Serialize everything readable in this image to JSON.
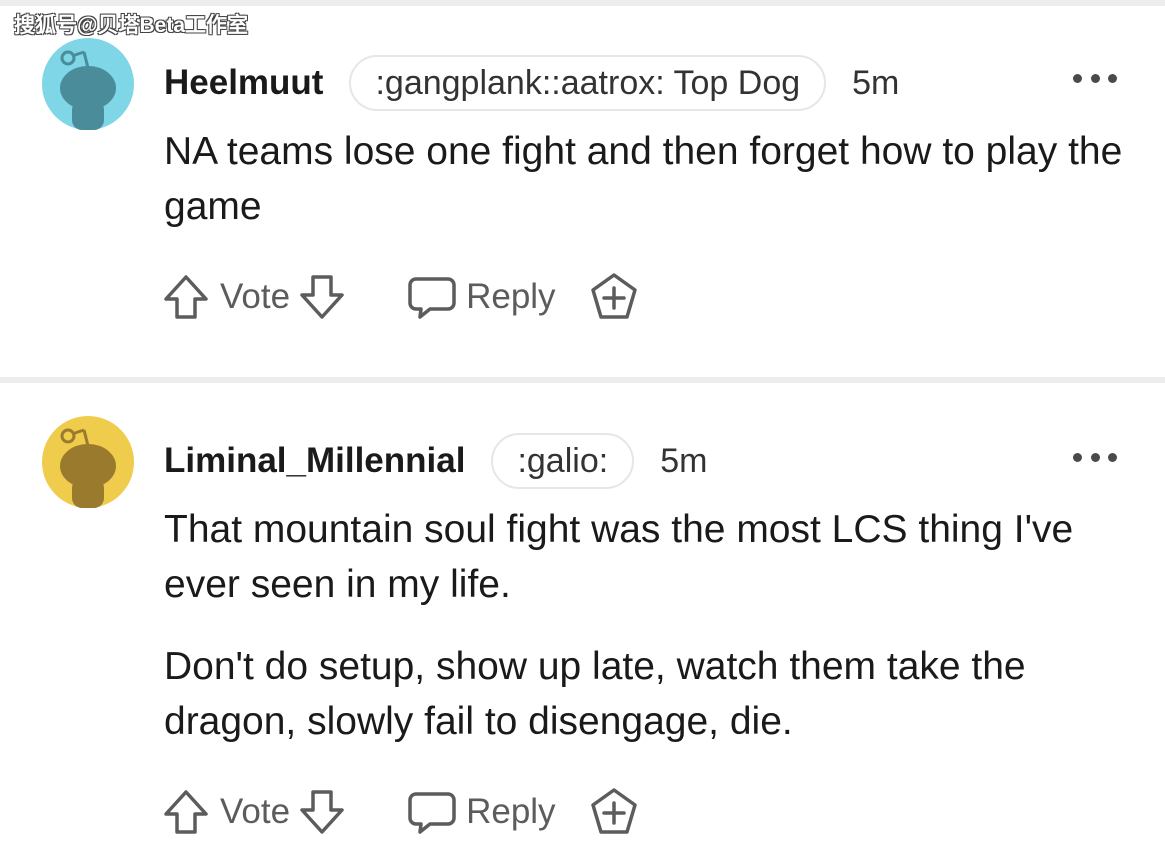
{
  "watermark": "搜狐号@贝塔Beta工作室",
  "comments": [
    {
      "username": "Heelmuut",
      "flair": ":gangplank::aatrox: Top Dog",
      "time": "5m",
      "avatar_bg": "#7fd6e6",
      "avatar_fg": "#4a8c9a",
      "paragraphs": [
        "NA teams lose one fight and then forget how to play the game"
      ],
      "vote_label": "Vote",
      "reply_label": "Reply"
    },
    {
      "username": "Liminal_Millennial",
      "flair": ":galio:",
      "time": "5m",
      "avatar_bg": "#f0cc4c",
      "avatar_fg": "#9a7b2e",
      "paragraphs": [
        "That mountain soul fight was the most LCS thing I've ever seen in my life.",
        "Don't do setup, show up late, watch them take the dragon, slowly fail to disengage, die."
      ],
      "vote_label": "Vote",
      "reply_label": "Reply"
    }
  ],
  "icons": {
    "upvote": "arrow-up-icon",
    "downvote": "arrow-down-icon",
    "reply": "speech-bubble-icon",
    "award": "award-plus-icon",
    "more": "more-options-icon"
  }
}
